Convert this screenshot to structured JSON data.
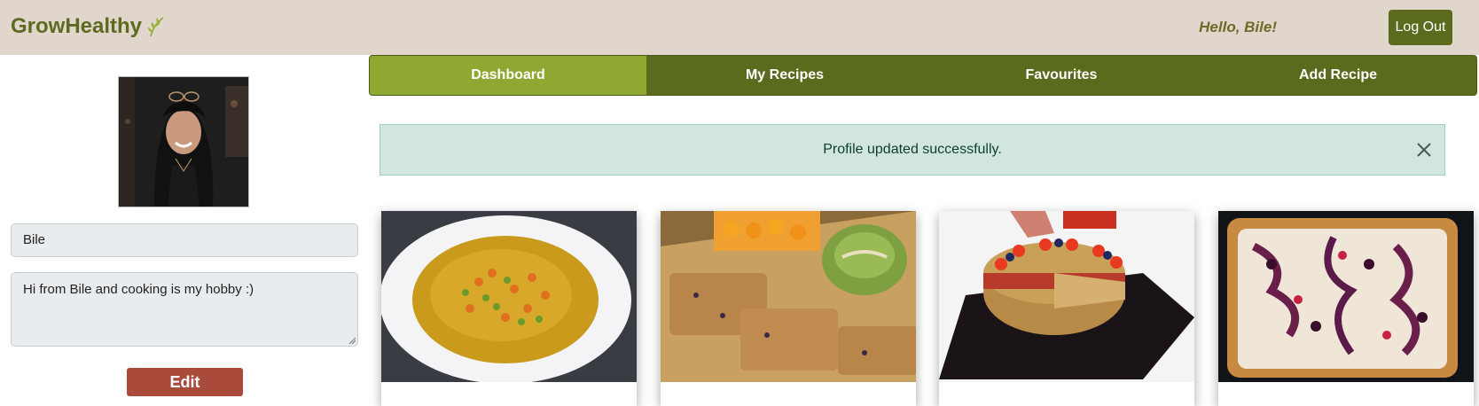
{
  "brand": {
    "name": "GrowHealthy",
    "icon": "leaf-icon"
  },
  "header": {
    "greeting": "Hello, Bile!",
    "logout_label": "Log Out"
  },
  "profile": {
    "name": "Bile",
    "bio": "Hi from Bile  and cooking is my hobby :)",
    "edit_label": "Edit"
  },
  "tabs": [
    {
      "label": "Dashboard",
      "active": true
    },
    {
      "label": "My Recipes",
      "active": false
    },
    {
      "label": "Favourites",
      "active": false
    },
    {
      "label": "Add Recipe",
      "active": false
    }
  ],
  "alert": {
    "message": "Profile updated successfully."
  },
  "colors": {
    "navbar": "#e0d6cb",
    "brand": "#5c6b20",
    "tab_bar": "#5a6b1e",
    "tab_active": "#8fa832",
    "alert_bg": "#d1e7dd",
    "edit_button": "#a94a3b"
  }
}
